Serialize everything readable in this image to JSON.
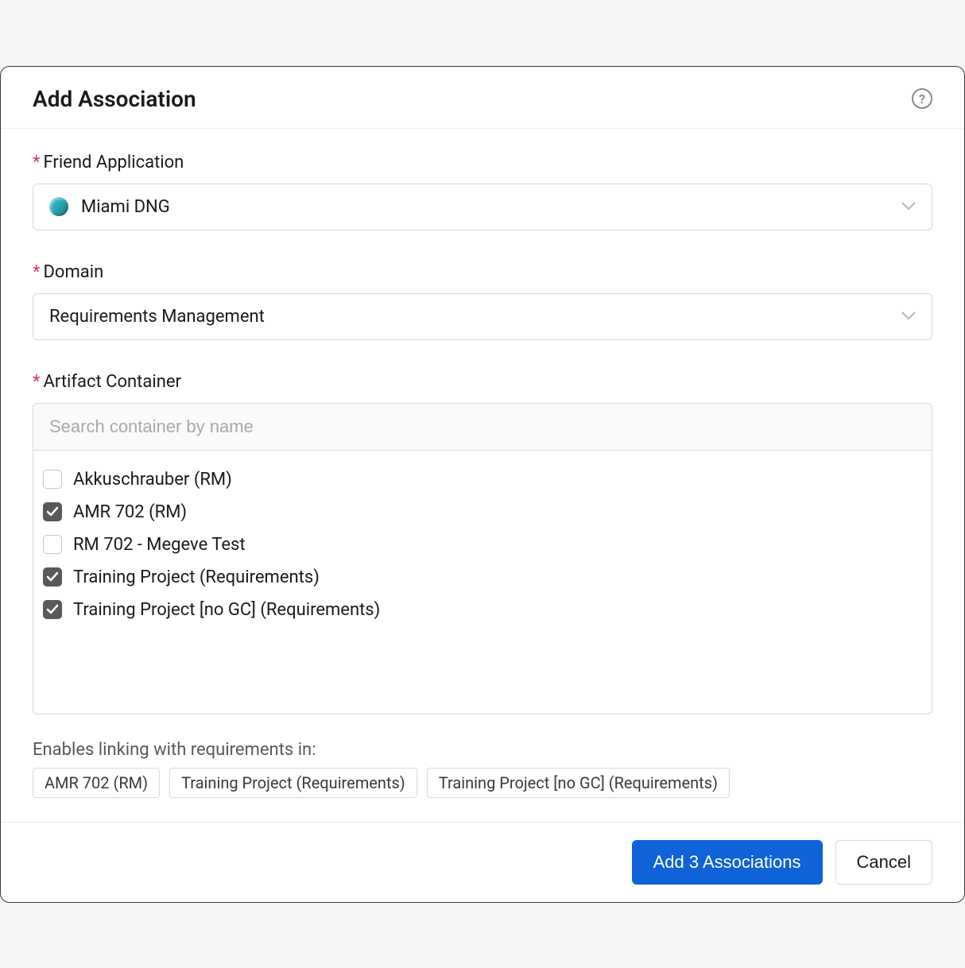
{
  "dialog": {
    "title": "Add Association"
  },
  "fields": {
    "friendApp": {
      "label": "Friend Application",
      "value": "Miami DNG"
    },
    "domain": {
      "label": "Domain",
      "value": "Requirements Management"
    },
    "artifactContainer": {
      "label": "Artifact Container",
      "placeholder": "Search container by name",
      "items": [
        {
          "label": "Akkuschrauber (RM)",
          "checked": false
        },
        {
          "label": "AMR 702 (RM)",
          "checked": true
        },
        {
          "label": "RM 702 - Megeve Test",
          "checked": false
        },
        {
          "label": "Training Project (Requirements)",
          "checked": true
        },
        {
          "label": "Training Project [no GC] (Requirements)",
          "checked": true
        }
      ]
    }
  },
  "summary": {
    "label": "Enables linking with requirements in:",
    "tags": [
      "AMR 702 (RM)",
      "Training Project (Requirements)",
      "Training Project [no GC] (Requirements)"
    ]
  },
  "footer": {
    "primary": "Add 3 Associations",
    "cancel": "Cancel"
  }
}
